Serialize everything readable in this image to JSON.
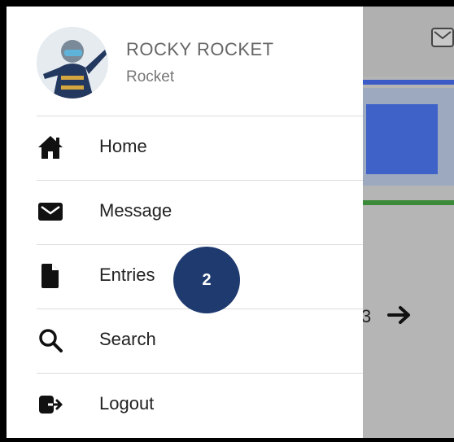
{
  "drawer": {
    "user": {
      "name": "ROCKY ROCKET",
      "subtitle": "Rocket"
    },
    "items": [
      {
        "label": "Home",
        "icon": "home-icon"
      },
      {
        "label": "Message",
        "icon": "envelope-icon"
      },
      {
        "label": "Entries",
        "icon": "document-icon"
      },
      {
        "label": "Search",
        "icon": "search-icon"
      },
      {
        "label": "Logout",
        "icon": "logout-icon"
      }
    ]
  },
  "badge": {
    "text": "2"
  },
  "background_app": {
    "page_fragment": "3"
  },
  "colors": {
    "badge": "#1e3a6e",
    "accent_blue": "#3f62c9",
    "accent_green": "#3a8a3a",
    "overlay": "#b5b5b5"
  }
}
